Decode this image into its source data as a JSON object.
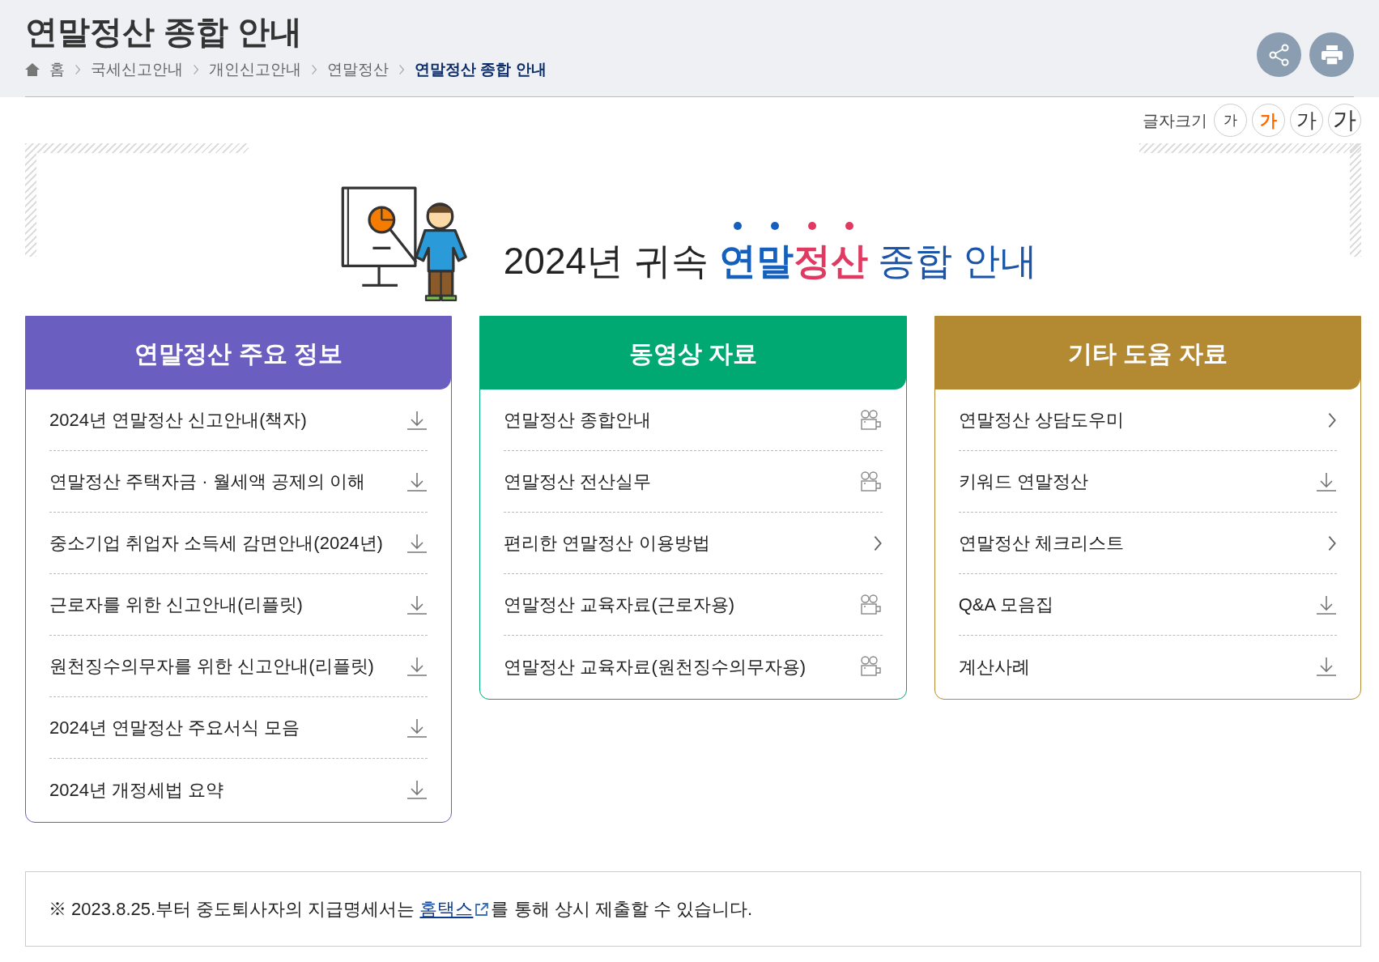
{
  "header": {
    "title": "연말정산 종합 안내",
    "breadcrumb": [
      {
        "label": "홈",
        "kind": "home",
        "current": false
      },
      {
        "label": "국세신고안내",
        "kind": "link",
        "current": false
      },
      {
        "label": "개인신고안내",
        "kind": "link",
        "current": false
      },
      {
        "label": "연말정산",
        "kind": "link",
        "current": false
      },
      {
        "label": "연말정산 종합 안내",
        "kind": "link",
        "current": true
      }
    ],
    "actions": [
      {
        "kind": "share"
      },
      {
        "kind": "print"
      }
    ]
  },
  "font_size": {
    "label": "글자크기",
    "options": [
      {
        "label": "가",
        "selected": false
      },
      {
        "label": "가",
        "selected": true
      },
      {
        "label": "가",
        "selected": false
      },
      {
        "label": "가",
        "selected": false
      }
    ]
  },
  "banner": {
    "segments": [
      {
        "text": "2024년 귀속 ",
        "kind": "plain"
      },
      {
        "text": "연말",
        "kind": "blue-bold"
      },
      {
        "text": "정산",
        "kind": "red-bold"
      },
      {
        "text": " 종합 안내",
        "kind": "blue"
      }
    ]
  },
  "panels": [
    {
      "title": "연말정산 주요 정보",
      "color": "#6a5fc1",
      "items": [
        {
          "label": "2024년 연말정산 신고안내(책자)",
          "kind": "download"
        },
        {
          "label": "연말정산 주택자금 · 월세액 공제의 이해",
          "kind": "download"
        },
        {
          "label": "중소기업 취업자 소득세 감면안내(2024년)",
          "kind": "download"
        },
        {
          "label": "근로자를 위한 신고안내(리플릿)",
          "kind": "download"
        },
        {
          "label": "원천징수의무자를 위한 신고안내(리플릿)",
          "kind": "download"
        },
        {
          "label": "2024년 연말정산 주요서식 모음",
          "kind": "download"
        },
        {
          "label": "2024년 개정세법 요약",
          "kind": "download"
        }
      ]
    },
    {
      "title": "동영상 자료",
      "color": "#00a971",
      "items": [
        {
          "label": "연말정산 종합안내",
          "kind": "video"
        },
        {
          "label": "연말정산 전산실무",
          "kind": "video"
        },
        {
          "label": "편리한 연말정산 이용방법",
          "kind": "link"
        },
        {
          "label": "연말정산 교육자료(근로자용)",
          "kind": "video"
        },
        {
          "label": "연말정산 교육자료(원천징수의무자용)",
          "kind": "video"
        }
      ]
    },
    {
      "title": "기타 도움 자료",
      "color": "#b38a32",
      "items": [
        {
          "label": "연말정산 상담도우미",
          "kind": "link"
        },
        {
          "label": "키워드 연말정산",
          "kind": "download"
        },
        {
          "label": "연말정산 체크리스트",
          "kind": "link"
        },
        {
          "label": "Q&A 모음집",
          "kind": "download"
        },
        {
          "label": "계산사례",
          "kind": "download"
        }
      ]
    }
  ],
  "notice": {
    "before": "※ 2023.8.25.부터 중도퇴사자의 지급명세서는 ",
    "link": "홈택스",
    "after": "를 통해 상시 제출할 수 있습니다."
  }
}
